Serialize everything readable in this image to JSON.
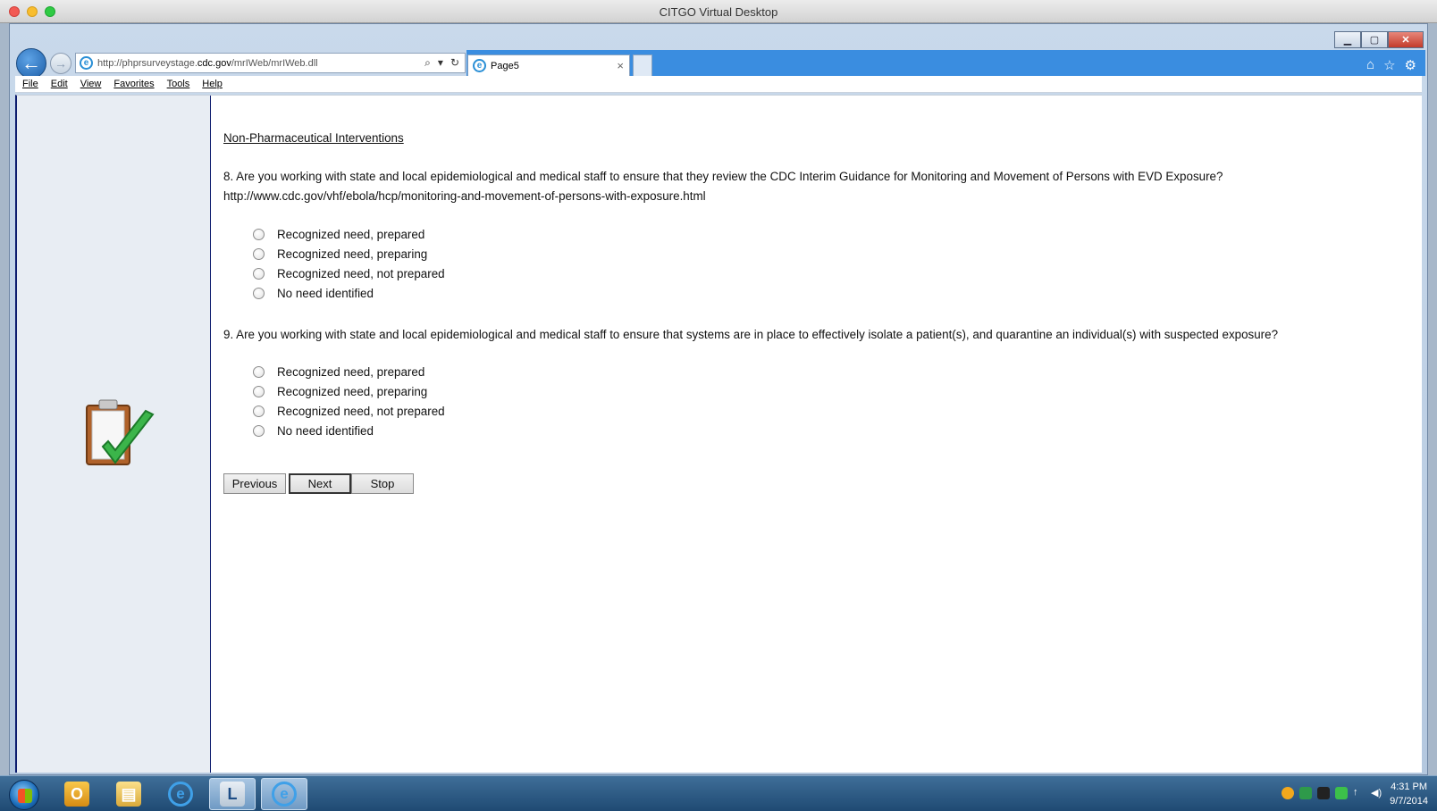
{
  "window": {
    "title": "CITGO Virtual Desktop"
  },
  "browser": {
    "address": {
      "prefix": "http://phprsurveystage.",
      "domain": "cdc.gov",
      "path": "/mrIWeb/mrIWeb.dll"
    },
    "tab_label": "Page5",
    "menu": [
      "File",
      "Edit",
      "View",
      "Favorites",
      "Tools",
      "Help"
    ]
  },
  "survey": {
    "section_title": "Non-Pharmaceutical Interventions",
    "questions": [
      {
        "text": "8. Are you working with state and local epidemiological and medical staff to ensure that they review the CDC Interim Guidance for Monitoring and Movement of Persons with EVD Exposure?",
        "link": "http://www.cdc.gov/vhf/ebola/hcp/monitoring-and-movement-of-persons-with-exposure.html",
        "options": [
          "Recognized need, prepared",
          "Recognized need, preparing",
          "Recognized need, not prepared",
          "No need identified"
        ]
      },
      {
        "text": "9. Are you working with state and local epidemiological and medical staff to ensure that systems are in place to effectively isolate a patient(s), and quarantine an individual(s) with suspected exposure?",
        "options": [
          "Recognized need, prepared",
          "Recognized need, preparing",
          "Recognized need, not prepared",
          "No need identified"
        ]
      }
    ],
    "buttons": {
      "previous": "Previous",
      "next": "Next",
      "stop": "Stop"
    }
  },
  "taskbar": {
    "clock_time": "4:31 PM",
    "clock_date": "9/7/2014"
  },
  "colors": {
    "tab_strip": "#3a8de0",
    "content_border": "#0c1c6e",
    "left_panel": "#e8edf3"
  }
}
